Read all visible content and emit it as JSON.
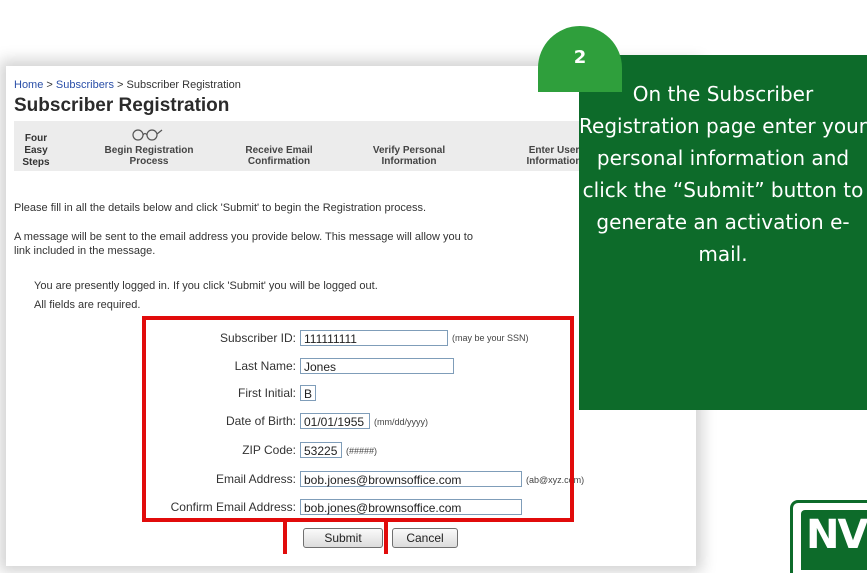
{
  "breadcrumb": {
    "home": "Home",
    "sep": " > ",
    "subscribers": "Subscribers",
    "current": "Subscriber Registration"
  },
  "page_title": "Subscriber Registration",
  "steps": {
    "header": [
      "Four",
      "Easy",
      "Steps"
    ],
    "items": [
      {
        "line1": "Begin Registration",
        "line2": "Process"
      },
      {
        "line1": "Receive Email",
        "line2": "Confirmation"
      },
      {
        "line1": "Verify Personal",
        "line2": "Information"
      },
      {
        "line1": "Enter User",
        "line2": "Information"
      }
    ]
  },
  "instructions": {
    "line1": "Please fill in all the details below and click 'Submit' to begin the Registration process.",
    "line2a": "A message will be sent to the email address you provide below. This message will allow you to",
    "line2b": "link included in the message.",
    "logged_in": "You are presently logged in. If you click 'Submit' you will be logged out.",
    "required": "All fields are required."
  },
  "form": {
    "subscriber_id": {
      "label": "Subscriber ID:",
      "value": "111111111",
      "hint": "(may be your SSN)"
    },
    "last_name": {
      "label": "Last Name:",
      "value": "Jones"
    },
    "first_initial": {
      "label": "First Initial:",
      "value": "B"
    },
    "dob": {
      "label": "Date of Birth:",
      "value": "01/01/1955",
      "hint": "(mm/dd/yyyy)"
    },
    "zip": {
      "label": "ZIP Code:",
      "value": "53225",
      "hint": "(#####)"
    },
    "email": {
      "label": "Email Address:",
      "value": "bob.jones@brownsoffice.com",
      "hint": "(ab@xyz.com)"
    },
    "confirm_email": {
      "label": "Confirm Email Address:",
      "value": "bob.jones@brownsoffice.com"
    }
  },
  "buttons": {
    "submit": "Submit",
    "cancel": "Cancel"
  },
  "callout": {
    "step_number": "2",
    "text": "On the Subscriber Registration page enter your personal information and click the “Submit” button to generate an activation e-mail."
  },
  "logo_text": "NV",
  "colors": {
    "highlight": "#e10b0b",
    "callout_bg": "#0d6b2a",
    "badge_bg": "#2f9f3c",
    "link": "#2a4fa8"
  }
}
